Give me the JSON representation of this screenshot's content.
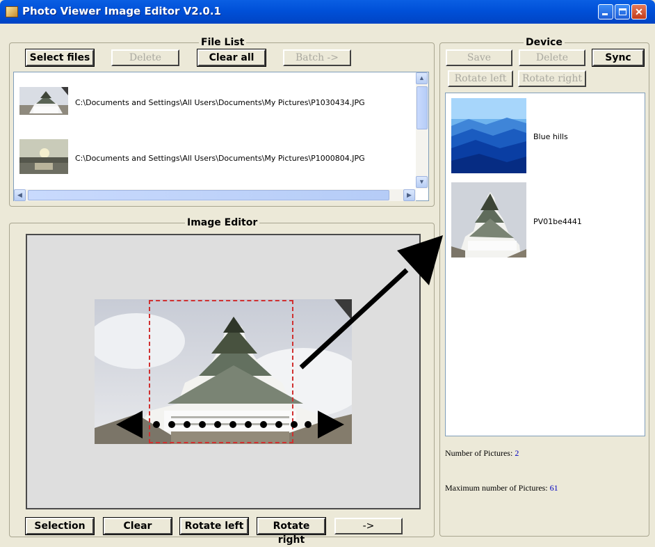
{
  "window": {
    "title": "Photo Viewer Image Editor V2.0.1"
  },
  "file_list": {
    "label": "File List",
    "buttons": {
      "select_files": "Select files",
      "delete": "Delete",
      "clear_all": "Clear all",
      "batch": "Batch ->"
    },
    "files": [
      {
        "path": "C:\\Documents and Settings\\All Users\\Documents\\My Pictures\\P1030434.JPG",
        "thumb": "castle"
      },
      {
        "path": "C:\\Documents and Settings\\All Users\\Documents\\My Pictures\\P1000804.JPG",
        "thumb": "sunset"
      }
    ]
  },
  "image_editor": {
    "label": "Image Editor",
    "buttons": {
      "selection": "Selection",
      "clear": "Clear",
      "rotate_left": "Rotate left",
      "rotate_right": "Rotate right",
      "send": "->"
    }
  },
  "device": {
    "label": "Device",
    "buttons": {
      "save": "Save",
      "delete": "Delete",
      "sync": "Sync",
      "rotate_left": "Rotate left",
      "rotate_right": "Rotate right"
    },
    "pictures": [
      {
        "name": "Blue hills",
        "thumb": "blue-hills"
      },
      {
        "name": "PV01be4441",
        "thumb": "castle"
      }
    ],
    "count_label": "Number of Pictures:",
    "count_value": "2",
    "max_label": "Maximum number of Pictures:",
    "max_value": "61"
  },
  "colors": {
    "titlebar": "#0050d8",
    "selection_border": "#d03030",
    "info_number": "#0000c0"
  }
}
